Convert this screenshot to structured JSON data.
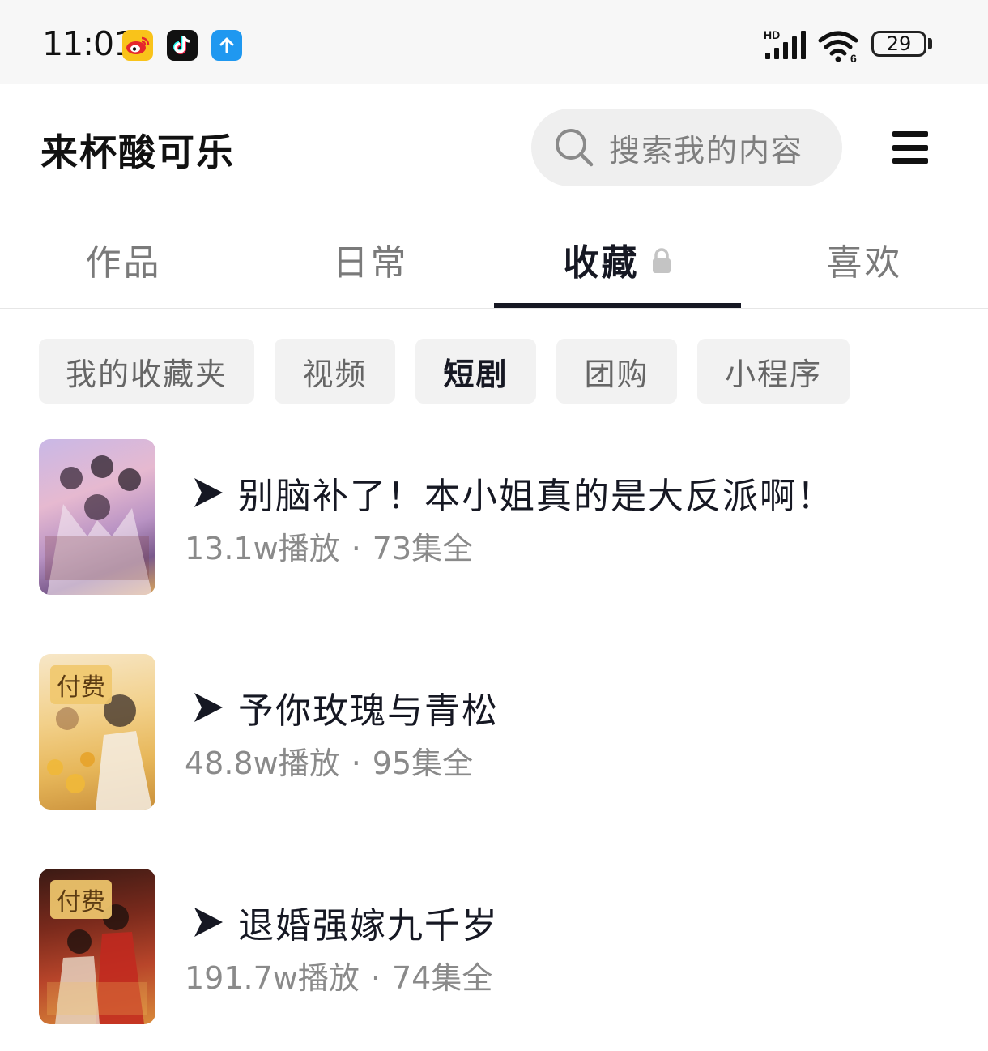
{
  "status_bar": {
    "time": "11:01",
    "network_label": "HD",
    "battery": "29",
    "app_icons": [
      "weibo-icon",
      "tiktok-icon",
      "upload-icon"
    ]
  },
  "header": {
    "username": "来杯酸可乐",
    "search_placeholder": "搜索我的内容"
  },
  "tabs": [
    {
      "label": "作品"
    },
    {
      "label": "日常"
    },
    {
      "label": "收藏",
      "locked": true
    },
    {
      "label": "喜欢"
    }
  ],
  "active_tab_index": 2,
  "filters": [
    {
      "label": "我的收藏夹"
    },
    {
      "label": "视频"
    },
    {
      "label": "短剧"
    },
    {
      "label": "团购"
    },
    {
      "label": "小程序"
    }
  ],
  "active_filter_index": 2,
  "dramas": [
    {
      "title": "别脑补了！本小姐真的是大反派啊！",
      "plays": "13.1w播放",
      "episodes": "73集全",
      "badge": ""
    },
    {
      "title": "予你玫瑰与青松",
      "plays": "48.8w播放",
      "episodes": "95集全",
      "badge": "付费"
    },
    {
      "title": "退婚强嫁九千岁",
      "plays": "191.7w播放",
      "episodes": "74集全",
      "badge": "付费"
    }
  ],
  "separator": "·",
  "colors": {
    "accent": "#161823",
    "muted": "#8a8a8a",
    "chip_bg": "#f2f2f2"
  }
}
